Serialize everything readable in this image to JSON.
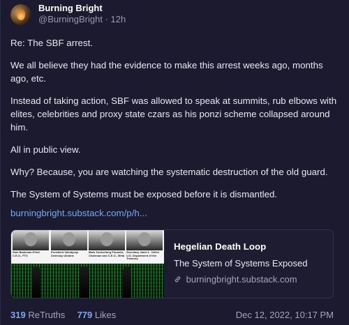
{
  "post": {
    "author_name": "Burning Bright",
    "handle": "@BurningBright",
    "age": "12h",
    "paragraphs": [
      "Re: The SBF arrest.",
      "We all believe they had the evidence to make this arrest weeks ago, months ago, etc.",
      "Instead of taking action, SBF was allowed to speak at summits, rub elbows with elites, celebrities and proxy state czars as his ponzi scheme collapsed around him.",
      "All in public view.",
      "Why? Because, you are watching the systematic destruction of the old guard.",
      "The System of Systems must be exposed before it is dismantled."
    ],
    "link_text": "burningbright.substack.com/p/h...",
    "link_card": {
      "title": "Hegelian Death Loop",
      "subtitle": "The System of Systems Exposed",
      "domain": "burningbright.substack.com",
      "thumbnail_captions": [
        "Sam Bankman-Fried C.E.O., FTX",
        "President Volodymyr Zelensky Ukraine",
        "Mark Zuckerberg Founder, Chairman and C.E.O., Meta",
        "Secretary Janet L. Yellen U.S. Department of the Treasury"
      ]
    },
    "stats": {
      "retruths_count": "319",
      "retruths_label": "ReTruths",
      "likes_count": "779",
      "likes_label": "Likes"
    },
    "timestamp": "Dec 12, 2022, 10:17 PM"
  },
  "colors": {
    "background": "#1b1a2e",
    "link": "#7aa7f5",
    "muted": "#a6a4bf"
  },
  "icons": {
    "avatar": "avatar-image",
    "link": "link-icon"
  }
}
